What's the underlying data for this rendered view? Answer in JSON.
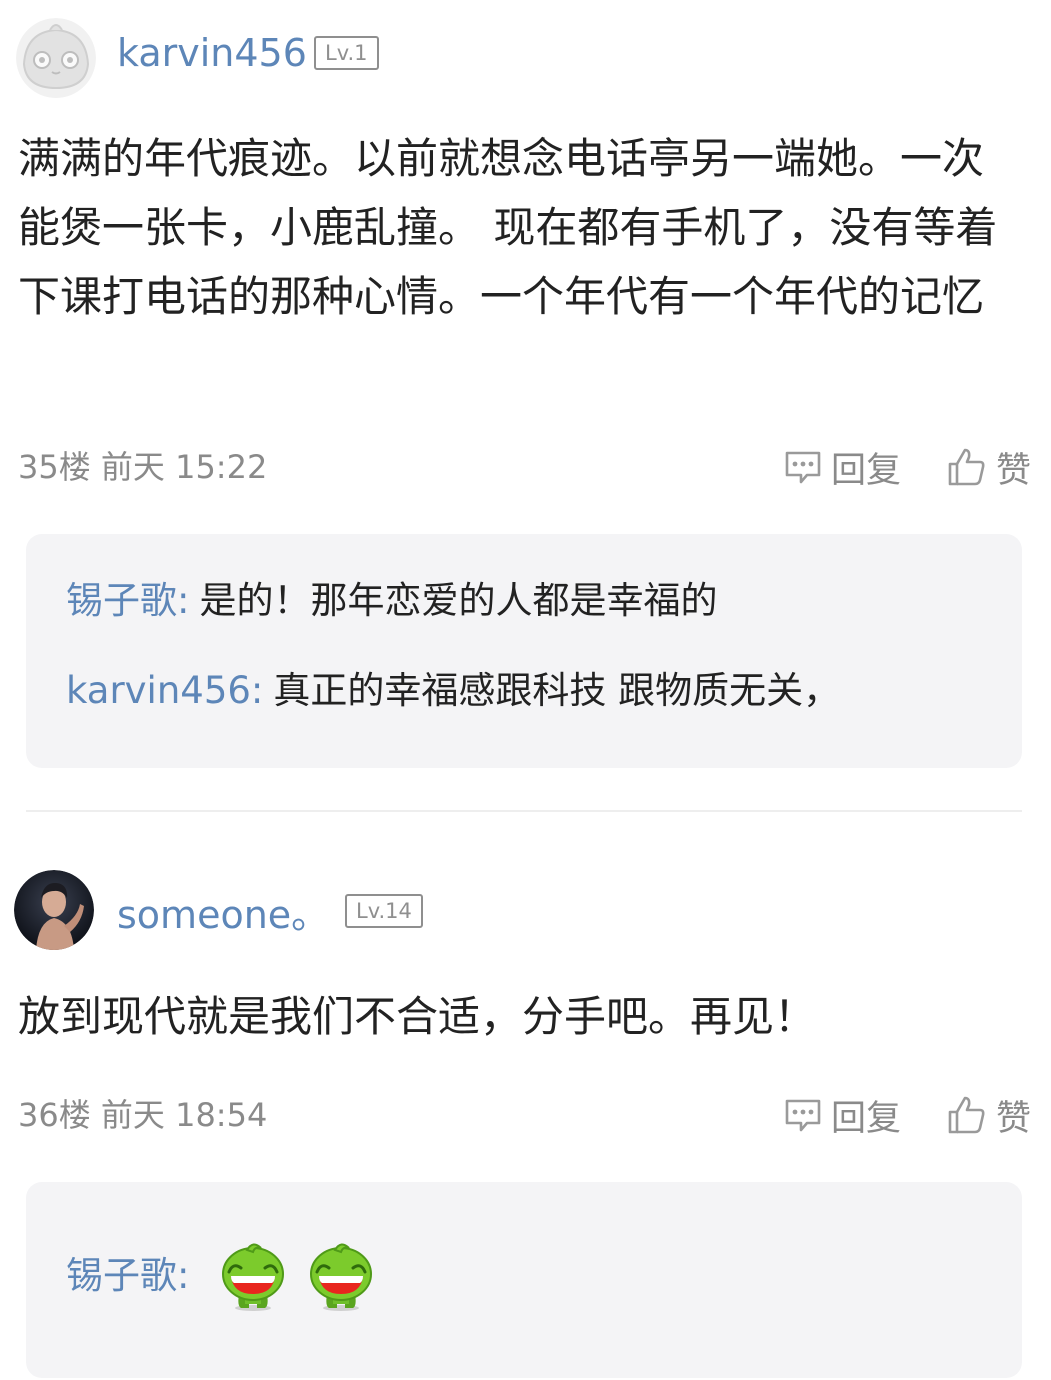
{
  "posts": [
    {
      "username": "karvin456",
      "level": "Lv.1",
      "content": "满满的年代痕迹。以前就想念电话亭另一端她。一次能煲一张卡，小鹿乱撞。 现在都有手机了，没有等着下课打电话的那种心情。一个年代有一个年代的记忆",
      "floor": "35楼",
      "time": "前天 15:22",
      "reply_label": "回复",
      "like_label": "赞",
      "sub_replies": [
        {
          "name": "锡子歌",
          "sep": ":",
          "text": "是的！那年恋爱的人都是幸福的"
        },
        {
          "name": "karvin456",
          "sep": ":",
          "text": "真正的幸福感跟科技 跟物质无关，"
        }
      ]
    },
    {
      "username": "someone。",
      "level": "Lv.14",
      "content": "放到现代就是我们不合适，分手吧。再见！",
      "floor": "36楼",
      "time": "前天 18:54",
      "reply_label": "回复",
      "like_label": "赞",
      "sub_replies": [
        {
          "name": "锡子歌",
          "sep": ":",
          "emojis": [
            "green-grin-emoji",
            "green-grin-emoji"
          ]
        }
      ]
    }
  ],
  "colors": {
    "username": "#5d86b8",
    "meta": "#8a8a8a",
    "sub_box_bg": "#f4f4f6",
    "content": "#222222"
  }
}
